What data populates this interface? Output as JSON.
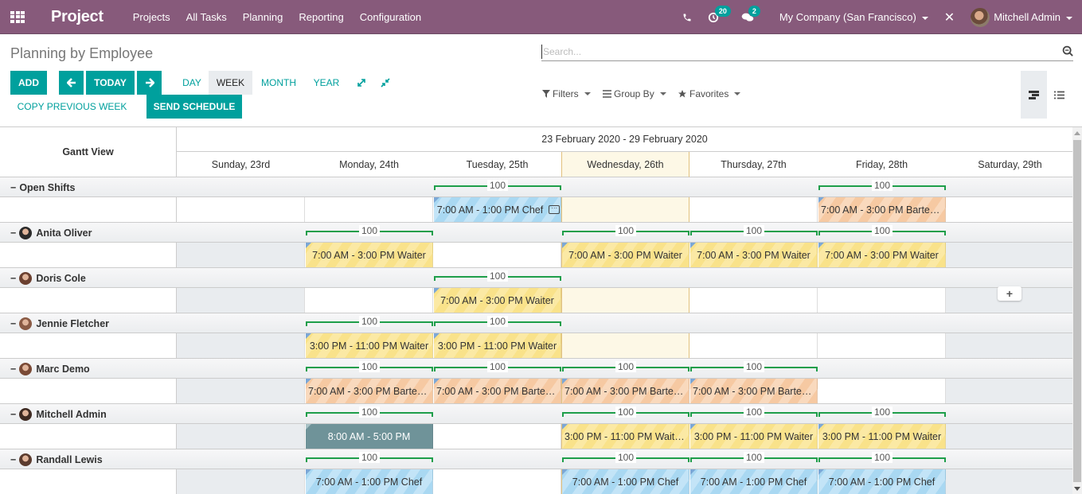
{
  "navbar": {
    "app_name": "Project",
    "menu": [
      "Projects",
      "All Tasks",
      "Planning",
      "Reporting",
      "Configuration"
    ],
    "activity_count": "20",
    "messages_count": "2",
    "company": "My Company (San Francisco)",
    "user": "Mitchell Admin",
    "brand_color": "#875a7b"
  },
  "control_panel": {
    "title": "Planning by Employee",
    "buttons": {
      "add": "ADD",
      "today": "TODAY",
      "copy_previous_week": "COPY PREVIOUS WEEK",
      "send_schedule": "SEND SCHEDULE"
    },
    "scales": [
      "DAY",
      "WEEK",
      "MONTH",
      "YEAR"
    ],
    "active_scale": "WEEK",
    "search_placeholder": "Search...",
    "filters": "Filters",
    "group_by": "Group By",
    "favorites": "Favorites",
    "accent_color": "#00a09d"
  },
  "gantt": {
    "title": "Gantt View",
    "range": "23 February 2020 - 29 February 2020",
    "days": [
      "Sunday, 23rd",
      "Monday, 24th",
      "Tuesday, 25th",
      "Wednesday, 26th",
      "Thursday, 27th",
      "Friday, 28th",
      "Saturday, 29th"
    ],
    "today_index": 3,
    "rows": [
      {
        "name": "Open Shifts",
        "avatar": false,
        "off_days": [],
        "shifts": [
          {
            "day": 2,
            "label": "7:00 AM - 1:00 PM Chef",
            "color": "blue",
            "comment": true,
            "allocation": "100"
          },
          {
            "day": 5,
            "label": "7:00 AM - 3:00 PM Barten...",
            "color": "orange",
            "allocation": "100"
          }
        ]
      },
      {
        "name": "Anita Oliver",
        "avatar": true,
        "off_days": [
          0,
          6
        ],
        "shifts": [
          {
            "day": 1,
            "label": "7:00 AM - 3:00 PM Waiter",
            "color": "yellow",
            "allocation": "100"
          },
          {
            "day": 3,
            "label": "7:00 AM - 3:00 PM Waiter",
            "color": "yellow",
            "allocation": "100"
          },
          {
            "day": 4,
            "label": "7:00 AM - 3:00 PM Waiter",
            "color": "yellow",
            "allocation": "100"
          },
          {
            "day": 5,
            "label": "7:00 AM - 3:00 PM Waiter",
            "color": "yellow",
            "allocation": "100"
          }
        ]
      },
      {
        "name": "Doris Cole",
        "avatar": true,
        "off_days": [
          0,
          6
        ],
        "shifts": [
          {
            "day": 2,
            "label": "7:00 AM - 3:00 PM Waiter",
            "color": "yellow",
            "allocation": "100"
          }
        ]
      },
      {
        "name": "Jennie Fletcher",
        "avatar": true,
        "off_days": [
          0,
          6
        ],
        "shifts": [
          {
            "day": 1,
            "label": "3:00 PM - 11:00 PM Waiter",
            "color": "yellow",
            "allocation": "100"
          },
          {
            "day": 2,
            "label": "3:00 PM - 11:00 PM Waiter",
            "color": "yellow",
            "allocation": "100"
          }
        ]
      },
      {
        "name": "Marc Demo",
        "avatar": true,
        "off_days": [
          0,
          6
        ],
        "shifts": [
          {
            "day": 1,
            "label": "7:00 AM - 3:00 PM Barten...",
            "color": "orange",
            "allocation": "100"
          },
          {
            "day": 2,
            "label": "7:00 AM - 3:00 PM Barten...",
            "color": "orange",
            "allocation": "100"
          },
          {
            "day": 3,
            "label": "7:00 AM - 3:00 PM Barten...",
            "color": "orange",
            "allocation": "100"
          },
          {
            "day": 4,
            "label": "7:00 AM - 3:00 PM Barten...",
            "color": "orange",
            "allocation": "100"
          }
        ]
      },
      {
        "name": "Mitchell Admin",
        "avatar": true,
        "off_days": [
          0,
          6
        ],
        "shifts": [
          {
            "day": 1,
            "label": "8:00 AM - 5:00 PM",
            "color": "gray",
            "allocation": "100"
          },
          {
            "day": 3,
            "label": "3:00 PM - 11:00 PM Waite...",
            "color": "yellow",
            "allocation": "100"
          },
          {
            "day": 4,
            "label": "3:00 PM - 11:00 PM Waiter",
            "color": "yellow",
            "allocation": "100"
          },
          {
            "day": 5,
            "label": "3:00 PM - 11:00 PM Waiter",
            "color": "yellow",
            "allocation": "100"
          }
        ]
      },
      {
        "name": "Randall Lewis",
        "avatar": true,
        "off_days": [
          0,
          6
        ],
        "shifts": [
          {
            "day": 1,
            "label": "7:00 AM - 1:00 PM Chef",
            "color": "blue",
            "allocation": "100"
          },
          {
            "day": 3,
            "label": "7:00 AM - 1:00 PM Chef",
            "color": "blue",
            "allocation": "100"
          },
          {
            "day": 4,
            "label": "7:00 AM - 1:00 PM Chef",
            "color": "blue",
            "allocation": "100"
          },
          {
            "day": 5,
            "label": "7:00 AM - 1:00 PM Chef",
            "color": "blue",
            "allocation": "100"
          }
        ]
      }
    ],
    "add_slot_label": "+"
  }
}
